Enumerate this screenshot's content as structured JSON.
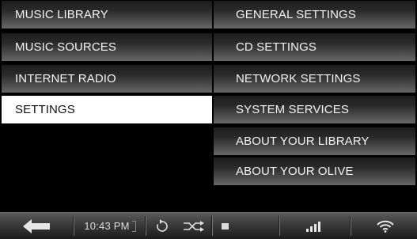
{
  "left_menu": [
    {
      "label": "MUSIC LIBRARY"
    },
    {
      "label": "MUSIC SOURCES"
    },
    {
      "label": "INTERNET RADIO"
    },
    {
      "label": "SETTINGS",
      "selected": true
    }
  ],
  "right_menu": [
    {
      "label": "GENERAL SETTINGS"
    },
    {
      "label": "CD SETTINGS"
    },
    {
      "label": "NETWORK SETTINGS"
    },
    {
      "label": "SYSTEM SERVICES"
    },
    {
      "label": "ABOUT YOUR LIBRARY"
    },
    {
      "label": "ABOUT YOUR OLIVE"
    }
  ],
  "statusbar": {
    "time": "10:43 PM",
    "icons": [
      "back-arrow-icon",
      "repeat-icon",
      "shuffle-icon",
      "stop-icon",
      "signal-bars-icon",
      "wifi-icon"
    ]
  },
  "colors": {
    "selected_bg": "#ffffff",
    "menu_text": "#f2f2f2",
    "background": "#000000"
  }
}
